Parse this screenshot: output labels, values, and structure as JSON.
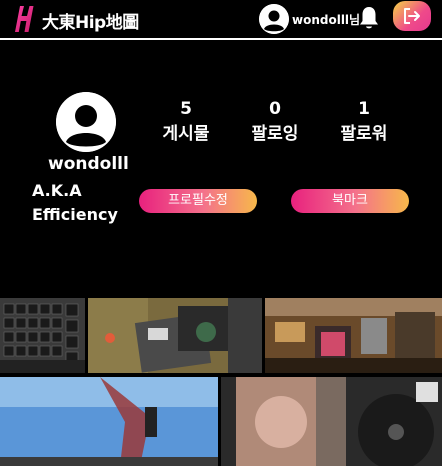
{
  "header": {
    "logo_letter": "H",
    "brand": "大東Hip地圖",
    "user_label": "wondolll님",
    "icons": {
      "avatar": "user-avatar-icon",
      "bell": "bell-icon",
      "logout": "logout-icon"
    }
  },
  "profile": {
    "username": "wondolll",
    "bio_line1": "A.K.A",
    "bio_line2": "Efficiency",
    "stats": [
      {
        "value": "5",
        "label": "게시물"
      },
      {
        "value": "0",
        "label": "팔로잉"
      },
      {
        "value": "1",
        "label": "팔로워"
      }
    ],
    "edit_label": "프로필수정",
    "bookmark_label": "북마크"
  },
  "colors": {
    "background": "#000000",
    "accent_gradient_start": "#e8217e",
    "accent_gradient_end": "#f7b84a"
  },
  "posts": [
    {
      "thumb": "wall-grid-photo"
    },
    {
      "thumb": "machine-photo"
    },
    {
      "thumb": "shop-interior-photo"
    },
    {
      "thumb": "sky-photo"
    },
    {
      "thumb": "record-player-photo"
    }
  ]
}
